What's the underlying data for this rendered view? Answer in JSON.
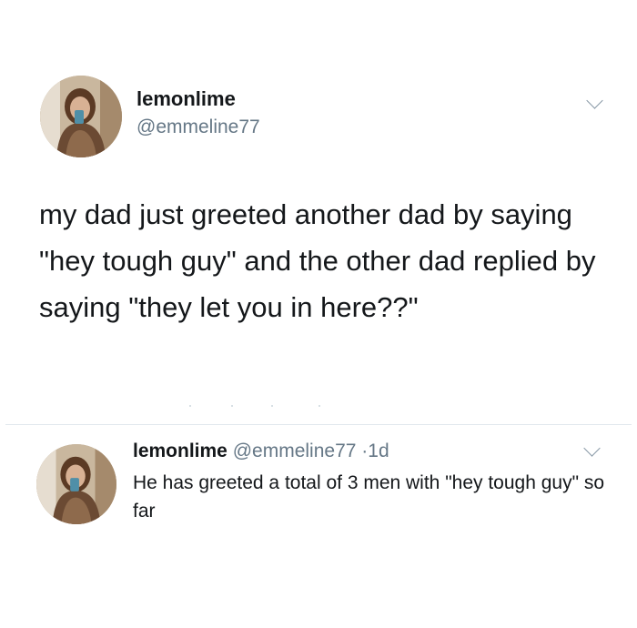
{
  "main_tweet": {
    "display_name": "lemonlime",
    "handle": "@emmeline77",
    "text": "my dad just greeted another dad by saying \"hey tough guy\" and the other dad replied by saying \"they let you in here??\""
  },
  "reply_tweet": {
    "display_name": "lemonlime",
    "handle": "@emmeline77",
    "separator": "·",
    "time": "1d",
    "text": "He has greeted a total of 3 men with \"hey tough guy\" so far"
  },
  "colors": {
    "text_primary": "#14171a",
    "text_secondary": "#657786",
    "divider": "#e1e8ed"
  },
  "icons": {
    "more_options": "chevron-down-icon"
  }
}
